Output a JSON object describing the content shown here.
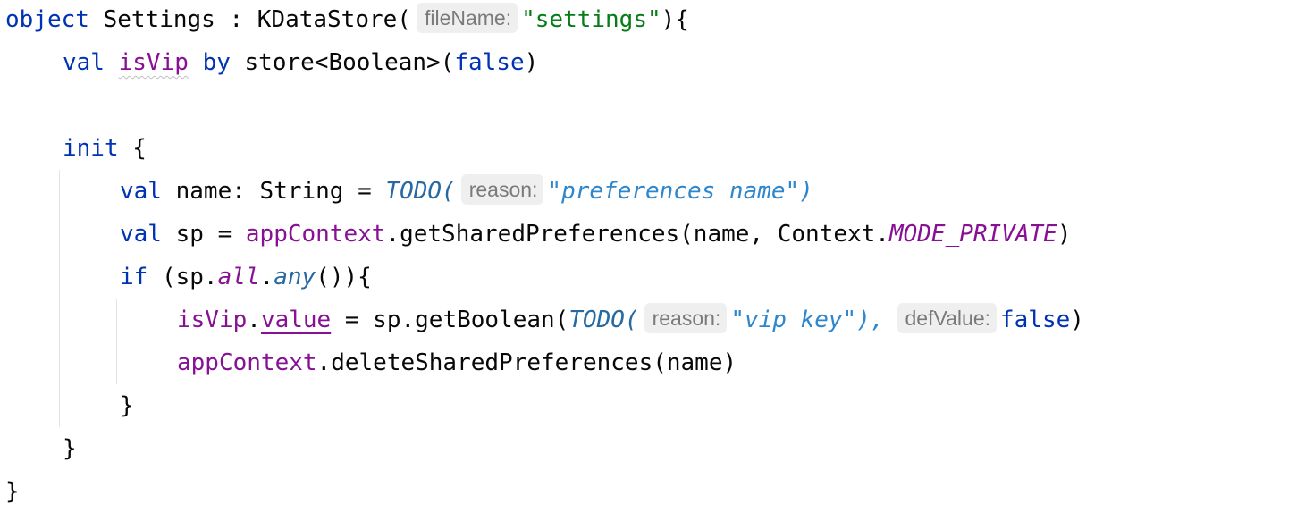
{
  "editor": {
    "lines": [
      {
        "t": "object Settings : KDataStore(",
        "hint": "fileName:",
        "s": "\"settings\"",
        "end": "){"
      },
      {
        "kw1": "val",
        "name": "isVip",
        "kw2": "by",
        "mid": "store<Boolean>(",
        "bool": "false",
        "end": ")"
      },
      {},
      {
        "kw": "init",
        "end": " {"
      },
      {
        "kw": "val",
        "mid": " name: String = ",
        "todo": "TODO(",
        "hint": "reason:",
        "s": "\"preferences name\")"
      },
      {
        "kw": "val",
        "mid": " sp = ",
        "fld": "appContext",
        "mid2": ".getSharedPreferences(name, Context.",
        "const": "MODE_PRIVATE",
        "end": ")"
      },
      {
        "kw": "if",
        "mid": " (sp.",
        "c1": "all",
        "dot": ".",
        "c2": "any",
        "end": "()){"
      },
      {
        "fld": "isVip",
        "dot": ".",
        "prop": "value",
        "mid": " = sp.getBoolean(",
        "todo": "TODO(",
        "hint": "reason:",
        "s": "\"vip key\"),",
        "hint2": "defValue:",
        "bool": "false",
        "end": ")"
      },
      {
        "fld": "appContext",
        "mid": ".deleteSharedPreferences(name)"
      },
      {
        "end": "}"
      },
      {
        "end": "}"
      },
      {
        "end": "}"
      }
    ]
  }
}
